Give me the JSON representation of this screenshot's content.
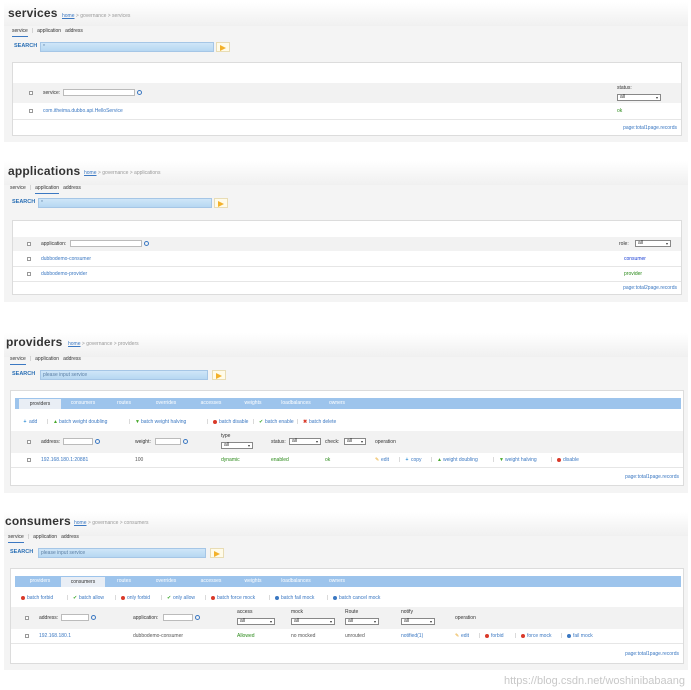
{
  "services": {
    "title": "services",
    "breadcrumb": {
      "home": "home",
      "rest": "> governance > services"
    },
    "tabs": [
      "service",
      "application",
      "address"
    ],
    "search_label": "SEARCH",
    "search_value": "*",
    "filter": {
      "service_label": "service:",
      "status_label": "status:",
      "status_value": "all"
    },
    "rows": [
      {
        "service": "com.itheima.dubbo.api.HelloService",
        "status": "ok"
      }
    ],
    "pager": "page:total1page.records"
  },
  "applications": {
    "title": "applications",
    "breadcrumb": {
      "home": "home",
      "rest": "> governance > applications"
    },
    "tabs": [
      "service",
      "application",
      "address"
    ],
    "search_label": "SEARCH",
    "search_value": "*",
    "filter": {
      "application_label": "application:",
      "role_label": "role:",
      "role_value": "all"
    },
    "rows": [
      {
        "application": "dubbodemo-consumer",
        "role": "consumer"
      },
      {
        "application": "dubbodemo-provider",
        "role": "provider"
      }
    ],
    "pager": "page:total2page.records"
  },
  "providers": {
    "title": "providers",
    "breadcrumb": {
      "home": "home",
      "rest": "> governance > providers"
    },
    "tabs": [
      "service",
      "application",
      "address"
    ],
    "search_label": "SEARCH",
    "search_placeholder": "please input service",
    "tabbar": [
      "providers",
      "consumers",
      "routes",
      "overrides",
      "accesses",
      "weights",
      "loadbalances",
      "owners"
    ],
    "actions": [
      "add",
      "batch weight doubling",
      "batch weight halving",
      "batch disable",
      "batch enable",
      "batch delete"
    ],
    "columns": {
      "address": "address:",
      "weight": "weight:",
      "type": "type",
      "type_value": "all",
      "status": "status:",
      "status_value": "all",
      "check": "check:",
      "check_value": "all",
      "operation": "operation"
    },
    "rows": [
      {
        "address": "192.168.180.1:20881",
        "weight": "100",
        "type": "dynamic",
        "status": "enabled",
        "check": "ok"
      }
    ],
    "row_ops": [
      "edit",
      "copy",
      "weight doubling",
      "weight halving",
      "disable"
    ],
    "pager": "page:total1page.records"
  },
  "consumers": {
    "title": "consumers",
    "breadcrumb": {
      "home": "home",
      "rest": "> governance > consumers"
    },
    "tabs": [
      "service",
      "application",
      "address"
    ],
    "search_label": "SEARCH",
    "search_placeholder": "please input service",
    "tabbar": [
      "providers",
      "consumers",
      "routes",
      "overrides",
      "accesses",
      "weights",
      "loadbalances",
      "owners"
    ],
    "actions": [
      "batch forbid",
      "batch allow",
      "only forbid",
      "only allow",
      "batch force mock",
      "batch fail mock",
      "batch cancel mock"
    ],
    "columns": {
      "address": "address:",
      "application": "application:",
      "access": "access",
      "access_value": "all",
      "mock": "mock",
      "mock_value": "all",
      "route": "Route",
      "route_value": "all",
      "notify": "notify",
      "notify_value": "all",
      "operation": "operation"
    },
    "rows": [
      {
        "address": "192.168.180.1",
        "application": "dubbodemo-consumer",
        "access": "Allowed",
        "mock": "no mocked",
        "route": "unrouted",
        "notify": "notified(1)"
      }
    ],
    "row_ops": [
      "edit",
      "forbid",
      "force mock",
      "fail mock"
    ],
    "pager": "page:total1page.records"
  },
  "watermark": "https://blog.csdn.net/woshinibabaang"
}
